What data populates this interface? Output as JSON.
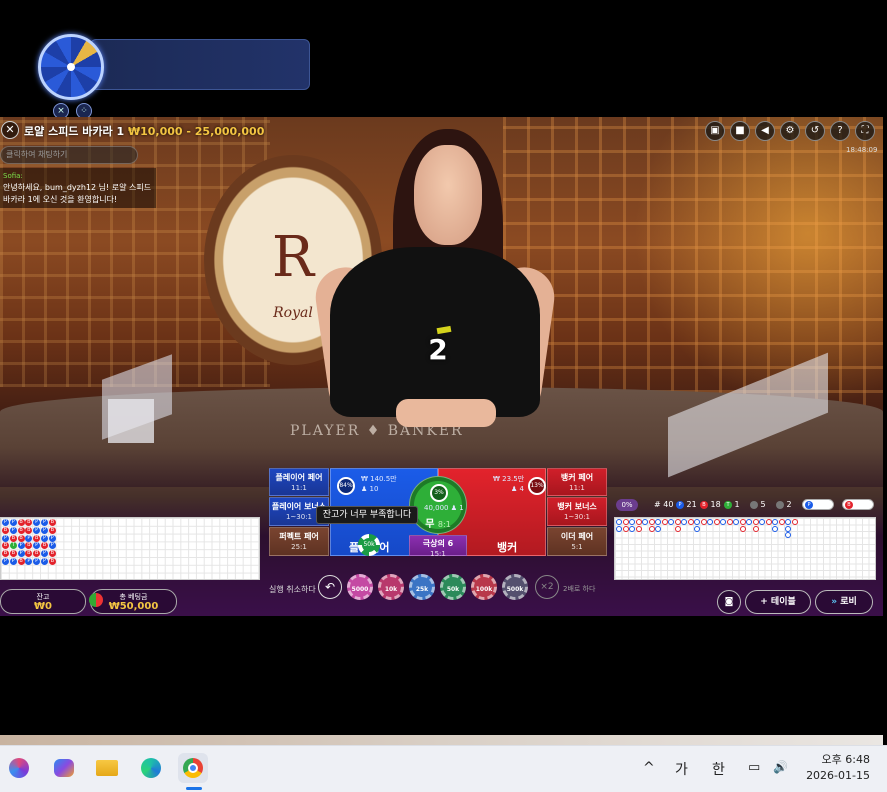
{
  "overlay": {
    "close_icon": "×",
    "grid_icon": "⁘"
  },
  "game": {
    "title": "로얄 스피드 바카라 1",
    "limits": "₩10,000 - 25,000,000",
    "chat_placeholder": "클릭하여 채팅하기",
    "chat_sender": "Sofia:",
    "chat_message": "안녕하세요, bum_dyzh12 님! 로얄 스피드 바카라 1에 오신 것을 환영합니다!",
    "countdown": "2",
    "round_id": "18:48:09",
    "table_text": "PLAYER ♦ BANKER",
    "medallion_letter": "R",
    "medallion_word": "Royal"
  },
  "top_icons": [
    "chat-icon",
    "camera-icon",
    "volume-icon",
    "settings-icon",
    "history-icon",
    "help-icon",
    "fullscreen-icon"
  ],
  "top_icons_glyphs": [
    "▣",
    "■",
    "◀",
    "⚙",
    "↺",
    "?",
    "⛶"
  ],
  "bets": {
    "player_pair": {
      "label": "플레이어 페어",
      "odds": "11:1"
    },
    "player_bonus": {
      "label": "플레이어 보너스",
      "odds": "1~30:1"
    },
    "perfect_pair": {
      "label": "퍼펙트 페어",
      "odds": "25:1"
    },
    "banker_pair": {
      "label": "뱅커 페어",
      "odds": "11:1"
    },
    "banker_bonus": {
      "label": "뱅커 보너스",
      "odds": "1~30:1"
    },
    "either_pair": {
      "label": "이더 페어",
      "odds": "5:1"
    },
    "super_six": {
      "label": "극상의 6",
      "odds": "15:1"
    },
    "player": {
      "label": "플레이어",
      "pct": "84%",
      "amount": "₩ 140.5만",
      "players": "♟ 10"
    },
    "banker": {
      "label": "뱅커",
      "pct": "13%",
      "amount": "₩ 23.5만",
      "players": "♟ 4"
    },
    "tie": {
      "label": "무",
      "odds": "8:1",
      "pct": "3%",
      "amount": "40,000 ♟ 1"
    }
  },
  "tooltip": "잔고가 너무 부족합니다",
  "chips": {
    "undo_label": "실행 취소하다",
    "values": [
      "5000",
      "10k",
      "25k",
      "50k",
      "100k",
      "500k"
    ],
    "colors": [
      "#c44aa3",
      "#b8386c",
      "#3b74c4",
      "#2b8a5a",
      "#b8384a",
      "#54506e"
    ],
    "selected_chip": "50k",
    "double_label": "2배로 하다",
    "double_btn": "×2"
  },
  "wallet": {
    "balance_label": "잔고",
    "balance": "₩0",
    "total_bet_label": "총 베팅금",
    "total_bet": "₩50,000"
  },
  "stats": {
    "pct": "0%",
    "round": "# 40",
    "player_count": "21",
    "banker_count": "18",
    "tie_count": "1",
    "player_pair_count": "5",
    "banker_pair_count": "2",
    "p": "P",
    "b": "B",
    "t": "T"
  },
  "bead_road": [
    [
      "P",
      "P",
      "B",
      "B",
      "P",
      "P",
      "B"
    ],
    [
      "B",
      "P",
      "B",
      "B",
      "P",
      "P",
      "B"
    ],
    [
      "P",
      "B",
      "B",
      "P",
      "B",
      "P",
      "P"
    ],
    [
      "B",
      "T",
      "P",
      "B",
      "P",
      "B",
      "P"
    ],
    [
      "B",
      "B",
      "P",
      "B",
      "B",
      "P",
      "B"
    ],
    [
      "P",
      "P",
      "B",
      "P",
      "P",
      "P",
      "B"
    ]
  ],
  "buttons": {
    "table_label": "테이블",
    "lobby_label": "로비",
    "add_glyph": "+",
    "lobby_glyph": "»"
  },
  "taskbar": {
    "ime_chevron": "^",
    "ime_lang1": "가",
    "ime_lang2": "한",
    "volume": "🔊",
    "time": "오후 6:48",
    "date": "2026-01-15"
  },
  "colors": {
    "player": "#1b5ce8",
    "banker": "#e3232c",
    "tie": "#2eaf38",
    "gold": "#f3c542"
  }
}
